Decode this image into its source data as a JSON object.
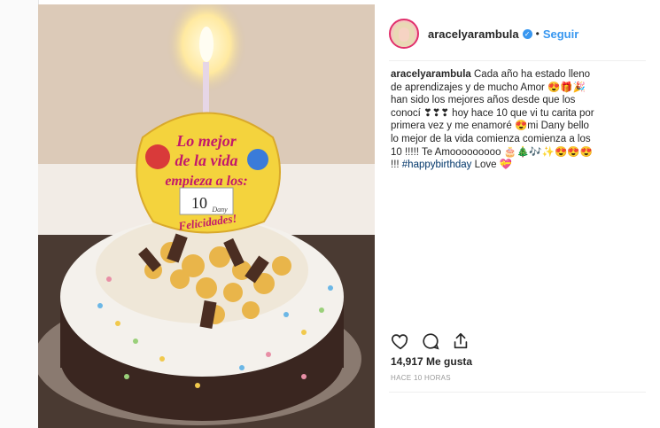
{
  "post": {
    "username": "aracelyarambula",
    "follow_label": "Seguir",
    "dot": "•",
    "caption_username": "aracelyarambula",
    "caption_text": " Cada año ha estado lleno de aprendizajes y de mucho Amor 😍🎁🎉 han sido los mejores años desde que los conocí ❣❣❣ hoy hace 10 que vi tu carita por primera vez y me enamoré 😍mi Dany bello lo mejor de la vida comienza comienza a los 10 !!!!! Te Amooooooooo 🎂🎄🎶✨😍😍😍 !!! ",
    "hashtag": "#happybirthday",
    "caption_tail": " Love 💝",
    "likes": "14,917 Me gusta",
    "time": "HACE 10 HORAS"
  },
  "photo": {
    "topper_text": [
      "Lo mejor",
      "de la vida",
      "empieza a los:"
    ],
    "topper_number": "10",
    "topper_name": "Dany",
    "topper_bottom": "Felicidades!"
  },
  "icons": {
    "like": "heart-icon",
    "comment": "comment-icon",
    "share": "share-icon",
    "verified": "verified-badge-icon"
  },
  "colors": {
    "link_blue": "#3897f0",
    "text": "#262626",
    "muted": "#999999"
  }
}
